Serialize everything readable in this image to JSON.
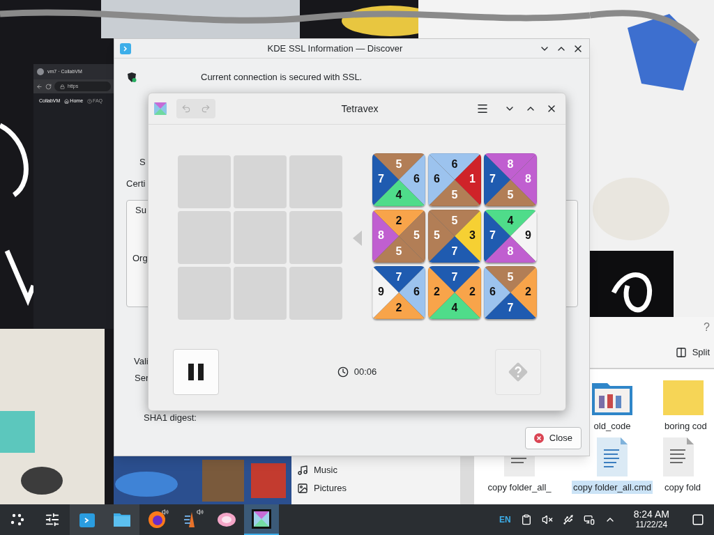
{
  "browser_window": {
    "tab_title": "vm7 · CollabVM",
    "address": "https",
    "nav": [
      "CollabVM",
      "Home",
      "FAQ"
    ]
  },
  "ssl_window": {
    "title": "KDE SSL Information — Discover",
    "message": "Current connection is secured with SSL.",
    "label_top": "S",
    "section": "Certi",
    "group_labels": [
      "Su",
      "Org"
    ],
    "field_labels": [
      "Vali",
      "Ser"
    ],
    "digest_label": "SHA1 digest:",
    "close_button": "Close"
  },
  "file_manager": {
    "places": [
      {
        "label": "Music",
        "kind": "music"
      },
      {
        "label": "Pictures",
        "kind": "pictures"
      }
    ],
    "help": "?",
    "split_button": "Split",
    "file_rows": [
      [
        {
          "name": "old_code",
          "kind": "picture-folder",
          "selected": false
        },
        {
          "name": "boring cod",
          "kind": "folder",
          "selected": false
        }
      ],
      [
        {
          "name": "copy folder_all_",
          "kind": "document",
          "selected": false
        },
        {
          "name": "copy folder_all.cmd",
          "kind": "script",
          "selected": true
        },
        {
          "name": "copy fold",
          "kind": "document",
          "selected": false
        }
      ]
    ]
  },
  "tetravex": {
    "title": "Tetravex",
    "undo": {
      "disabled": true
    },
    "redo": {
      "disabled": true
    },
    "hint": {
      "disabled": true
    },
    "timer": "00:06",
    "pieces": [
      {
        "top": {
          "value": "5",
          "color": "#b27e56"
        },
        "right": {
          "value": "6",
          "color": "#9cc3ee"
        },
        "bottom": {
          "value": "4",
          "color": "#4fdc8a"
        },
        "left": {
          "value": "7",
          "color": "#1f5bb0"
        }
      },
      {
        "top": {
          "value": "6",
          "color": "#9cc3ee"
        },
        "right": {
          "value": "1",
          "color": "#cf2329"
        },
        "bottom": {
          "value": "5",
          "color": "#b27e56"
        },
        "left": {
          "value": "6",
          "color": "#9cc3ee"
        }
      },
      {
        "top": {
          "value": "8",
          "color": "#c05fd0"
        },
        "right": {
          "value": "8",
          "color": "#c05fd0"
        },
        "bottom": {
          "value": "5",
          "color": "#b27e56"
        },
        "left": {
          "value": "7",
          "color": "#1f5bb0"
        }
      },
      {
        "top": {
          "value": "2",
          "color": "#f8a44a"
        },
        "right": {
          "value": "5",
          "color": "#b27e56"
        },
        "bottom": {
          "value": "5",
          "color": "#b27e56"
        },
        "left": {
          "value": "8",
          "color": "#c05fd0"
        }
      },
      {
        "top": {
          "value": "5",
          "color": "#b27e56"
        },
        "right": {
          "value": "3",
          "color": "#f6d033"
        },
        "bottom": {
          "value": "7",
          "color": "#1f5bb0"
        },
        "left": {
          "value": "5",
          "color": "#b27e56"
        }
      },
      {
        "top": {
          "value": "4",
          "color": "#4fdc8a"
        },
        "right": {
          "value": "9",
          "color": "#f4f4f4"
        },
        "bottom": {
          "value": "8",
          "color": "#c05fd0"
        },
        "left": {
          "value": "7",
          "color": "#1f5bb0"
        }
      },
      {
        "top": {
          "value": "7",
          "color": "#1f5bb0"
        },
        "right": {
          "value": "6",
          "color": "#9cc3ee"
        },
        "bottom": {
          "value": "2",
          "color": "#f8a44a"
        },
        "left": {
          "value": "9",
          "color": "#f4f4f4"
        }
      },
      {
        "top": {
          "value": "7",
          "color": "#1f5bb0"
        },
        "right": {
          "value": "2",
          "color": "#f8a44a"
        },
        "bottom": {
          "value": "4",
          "color": "#4fdc8a"
        },
        "left": {
          "value": "2",
          "color": "#f8a44a"
        }
      },
      {
        "top": {
          "value": "5",
          "color": "#b27e56"
        },
        "right": {
          "value": "2",
          "color": "#f8a44a"
        },
        "bottom": {
          "value": "7",
          "color": "#1f5bb0"
        },
        "left": {
          "value": "6",
          "color": "#9cc3ee"
        }
      }
    ]
  },
  "taskbar": {
    "items": [
      {
        "kind": "launcher",
        "selected": false,
        "open": false,
        "audio": false
      },
      {
        "kind": "settings",
        "selected": false,
        "open": false,
        "audio": false
      },
      {
        "kind": "discover",
        "selected": false,
        "open": true,
        "audio": false
      },
      {
        "kind": "files",
        "selected": false,
        "open": true,
        "audio": false
      },
      {
        "kind": "firefox",
        "selected": false,
        "open": false,
        "audio": true
      },
      {
        "kind": "media",
        "selected": false,
        "open": false,
        "audio": true
      },
      {
        "kind": "viewer",
        "selected": false,
        "open": false,
        "audio": false
      },
      {
        "kind": "tetravex",
        "selected": true,
        "open": true,
        "audio": false
      }
    ],
    "language": "EN",
    "muted": true,
    "time": "8:24 AM",
    "date": "11/22/24"
  }
}
